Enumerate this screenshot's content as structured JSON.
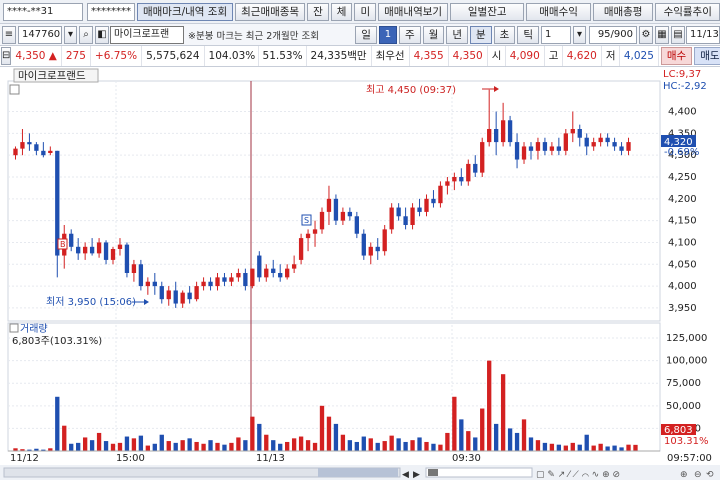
{
  "toolbar": {
    "account": "****-**31",
    "password": "********",
    "buttons": [
      "매매마크/내역 조회",
      "최근매매종목",
      "잔",
      "체",
      "미",
      "매매내역보기"
    ],
    "right_buttons": [
      "일별잔고",
      "매매수익",
      "매매총평",
      "수익률추이"
    ]
  },
  "toolbar2": {
    "code": "147760",
    "stock_name": "마이크로프랜",
    "notice": "※분봉 마크는 최근 2개월만 조회",
    "period_tabs": [
      "일",
      "1",
      "주",
      "월",
      "년",
      "분",
      "초",
      "틱"
    ],
    "interval": "1",
    "count": "95/900",
    "date": "11/13"
  },
  "quote": {
    "price": "4,350",
    "change": "275",
    "change_pct": "+6.75%",
    "volume": "5,575,624",
    "vol_ratio": "104.03%",
    "ratio2": "51.53%",
    "amount": "24,335백만",
    "label_best_ask": "최우선",
    "best": "4,355",
    "ask": "4,350",
    "label_high": "고",
    "high": "4,620",
    "label_low": "저",
    "low": "4,025",
    "label_mid": "시",
    "low2": "4,090",
    "buy_label": "매수",
    "sell_label": "매도"
  },
  "chart_data": {
    "type": "candlestick",
    "title": "마이크로프랜드",
    "lc": "LC:9,37",
    "hc": "HC:-2,92",
    "price_ticks": [
      "4,400",
      "4,350",
      "4,300",
      "4,250",
      "4,200",
      "4,150",
      "4,100",
      "4,050",
      "4,000",
      "3,950"
    ],
    "ylim": [
      3920,
      4470
    ],
    "current_price": "4,320",
    "current_change": "-0.69%",
    "annotations": {
      "high": "최고 4,450 (09:37)",
      "low": "최저 3,950 (15:06)"
    },
    "volume_title": "거래량",
    "volume_info": "6,803주(103.31%)",
    "volume_ticks": [
      "125,000",
      "100,000",
      "75,000",
      "50,000",
      "25,000"
    ],
    "volume_max": 135000,
    "volume_current": "6,803",
    "volume_current_pct": "103.31%",
    "x_labels": [
      "11/12",
      "15:00",
      "11/13",
      "09:30",
      "09:57:00"
    ],
    "candles": [
      [
        4300,
        4320,
        4290,
        4315
      ],
      [
        4315,
        4360,
        4300,
        4330
      ],
      [
        4330,
        4350,
        4310,
        4325
      ],
      [
        4325,
        4330,
        4300,
        4310
      ],
      [
        4310,
        4330,
        4295,
        4300
      ],
      [
        4305,
        4320,
        4300,
        4310
      ],
      [
        4310,
        4310,
        4020,
        4070
      ],
      [
        4070,
        4140,
        4040,
        4120
      ],
      [
        4120,
        4130,
        4080,
        4090
      ],
      [
        4090,
        4110,
        4060,
        4075
      ],
      [
        4075,
        4100,
        4060,
        4090
      ],
      [
        4090,
        4110,
        4070,
        4075
      ],
      [
        4075,
        4110,
        4065,
        4100
      ],
      [
        4100,
        4105,
        4050,
        4060
      ],
      [
        4060,
        4090,
        4050,
        4085
      ],
      [
        4085,
        4110,
        4070,
        4095
      ],
      [
        4095,
        4100,
        4020,
        4030
      ],
      [
        4030,
        4060,
        4010,
        4050
      ],
      [
        4050,
        4060,
        3990,
        4000
      ],
      [
        4000,
        4020,
        3980,
        4010
      ],
      [
        4010,
        4030,
        3980,
        4000
      ],
      [
        4000,
        4010,
        3960,
        3970
      ],
      [
        3970,
        4000,
        3955,
        3990
      ],
      [
        3990,
        4010,
        3950,
        3960
      ],
      [
        3960,
        3990,
        3950,
        3985
      ],
      [
        3985,
        4000,
        3960,
        3970
      ],
      [
        3970,
        4010,
        3965,
        4000
      ],
      [
        4000,
        4020,
        3990,
        4010
      ],
      [
        4010,
        4020,
        3990,
        4000
      ],
      [
        4000,
        4030,
        3990,
        4020
      ],
      [
        4020,
        4030,
        4000,
        4010
      ],
      [
        4010,
        4030,
        4000,
        4020
      ],
      [
        4020,
        4040,
        4010,
        4030
      ],
      [
        4030,
        4040,
        3990,
        4000
      ],
      [
        4000,
        4040,
        3995,
        4040
      ],
      [
        4070,
        4080,
        4010,
        4020
      ],
      [
        4020,
        4050,
        4010,
        4040
      ],
      [
        4040,
        4060,
        4020,
        4030
      ],
      [
        4030,
        4050,
        4010,
        4020
      ],
      [
        4020,
        4050,
        4015,
        4040
      ],
      [
        4040,
        4070,
        4030,
        4050
      ],
      [
        4060,
        4120,
        4050,
        4110
      ],
      [
        4110,
        4130,
        4080,
        4120
      ],
      [
        4120,
        4150,
        4090,
        4130
      ],
      [
        4130,
        4180,
        4120,
        4170
      ],
      [
        4170,
        4230,
        4140,
        4200
      ],
      [
        4200,
        4210,
        4140,
        4150
      ],
      [
        4150,
        4180,
        4140,
        4170
      ],
      [
        4170,
        4180,
        4150,
        4160
      ],
      [
        4160,
        4170,
        4110,
        4120
      ],
      [
        4120,
        4130,
        4060,
        4070
      ],
      [
        4070,
        4100,
        4050,
        4090
      ],
      [
        4090,
        4110,
        4060,
        4080
      ],
      [
        4080,
        4140,
        4070,
        4130
      ],
      [
        4130,
        4190,
        4120,
        4180
      ],
      [
        4180,
        4190,
        4150,
        4160
      ],
      [
        4160,
        4180,
        4130,
        4140
      ],
      [
        4140,
        4190,
        4130,
        4180
      ],
      [
        4180,
        4200,
        4160,
        4170
      ],
      [
        4170,
        4210,
        4160,
        4200
      ],
      [
        4200,
        4220,
        4180,
        4190
      ],
      [
        4190,
        4240,
        4180,
        4230
      ],
      [
        4230,
        4250,
        4210,
        4240
      ],
      [
        4240,
        4260,
        4220,
        4250
      ],
      [
        4250,
        4270,
        4230,
        4240
      ],
      [
        4240,
        4290,
        4230,
        4280
      ],
      [
        4280,
        4300,
        4250,
        4260
      ],
      [
        4260,
        4340,
        4250,
        4330
      ],
      [
        4330,
        4450,
        4320,
        4360
      ],
      [
        4360,
        4400,
        4300,
        4330
      ],
      [
        4330,
        4420,
        4320,
        4380
      ],
      [
        4380,
        4390,
        4320,
        4330
      ],
      [
        4330,
        4350,
        4270,
        4290
      ],
      [
        4290,
        4330,
        4280,
        4320
      ],
      [
        4320,
        4330,
        4290,
        4310
      ],
      [
        4310,
        4340,
        4290,
        4330
      ],
      [
        4330,
        4340,
        4300,
        4310
      ],
      [
        4310,
        4330,
        4300,
        4320
      ],
      [
        4320,
        4340,
        4300,
        4310
      ],
      [
        4310,
        4360,
        4300,
        4350
      ],
      [
        4350,
        4400,
        4330,
        4360
      ],
      [
        4360,
        4370,
        4320,
        4340
      ],
      [
        4340,
        4350,
        4300,
        4320
      ],
      [
        4320,
        4340,
        4310,
        4330
      ],
      [
        4330,
        4350,
        4320,
        4340
      ],
      [
        4340,
        4350,
        4320,
        4330
      ],
      [
        4330,
        4340,
        4310,
        4320
      ],
      [
        4320,
        4330,
        4300,
        4310
      ],
      [
        4310,
        4340,
        4300,
        4330
      ]
    ],
    "volumes": [
      3000,
      2000,
      1500,
      2500,
      1500,
      3000,
      60000,
      28000,
      8000,
      9000,
      15000,
      12000,
      20000,
      11000,
      8000,
      9000,
      16000,
      14000,
      17000,
      6000,
      8000,
      18000,
      11000,
      9000,
      12000,
      14000,
      10000,
      8000,
      12000,
      9000,
      7000,
      9000,
      15000,
      12000,
      38000,
      30000,
      18000,
      12000,
      8000,
      10000,
      14000,
      16000,
      12000,
      9000,
      50000,
      38000,
      30000,
      18000,
      12000,
      10000,
      16000,
      14000,
      9000,
      11000,
      17000,
      14000,
      10000,
      12000,
      15000,
      10000,
      8000,
      7000,
      20000,
      60000,
      35000,
      22000,
      15000,
      47000,
      100000,
      30000,
      85000,
      25000,
      20000,
      35000,
      15000,
      12000,
      9000,
      8000,
      7000,
      6000,
      9000,
      7000,
      18000,
      6000,
      8000,
      5000,
      6000,
      4000,
      7000,
      6803
    ]
  }
}
